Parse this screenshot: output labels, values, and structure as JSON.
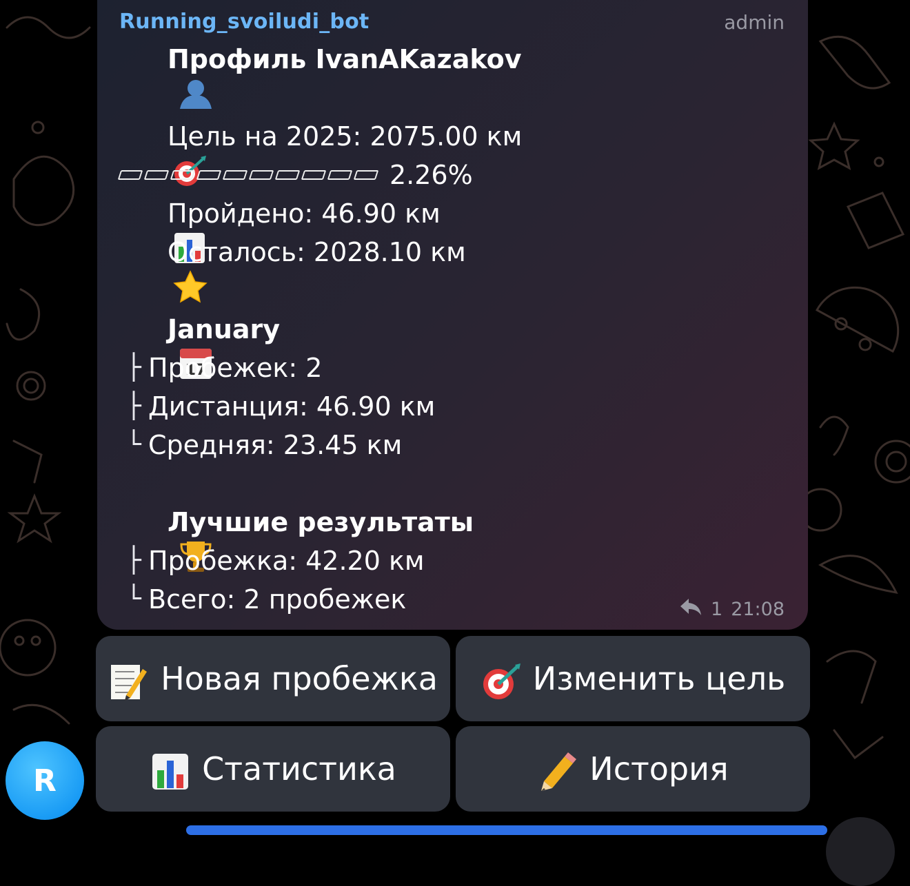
{
  "message": {
    "sender": "Running_svoiludi_bot",
    "role": "admin",
    "header": "Профиль IvanAKazakov",
    "goal": "Цель на 2025: 2075.00 км",
    "progress_percent": "2.26%",
    "progress_value": 0.0226,
    "done": "Пройдено: 46.90 км",
    "left": "Осталось: 2028.10 км",
    "month_title": "January",
    "month_stats": [
      {
        "prefix": "├",
        "text": "Пробежек: 2"
      },
      {
        "prefix": "├",
        "text": "Дистанция: 46.90 км"
      },
      {
        "prefix": "└",
        "text": "Средняя: 23.45 км"
      }
    ],
    "best_title": "Лучшие результаты",
    "best_stats": [
      {
        "prefix": "├",
        "text": "Пробежка: 42.20 км"
      },
      {
        "prefix": "└",
        "text": "Всего: 2 пробежек"
      }
    ],
    "reply_count": "1",
    "time": "21:08"
  },
  "keyboard": {
    "new_run": "Новая пробежка",
    "change_goal": "Изменить цель",
    "statistics": "Статистика",
    "history": "История"
  },
  "avatar": {
    "letter": "R",
    "color": "#1a9cf5"
  },
  "icons": {
    "profile": "user-silhouette-icon",
    "goal": "target-icon",
    "done": "bar-chart-icon",
    "left": "star-icon",
    "month": "calendar-icon",
    "best": "trophy-icon",
    "new_run": "memo-icon",
    "history": "pencil-icon"
  },
  "colors": {
    "accent": "#6cb6f6",
    "avatar": "#1a9cf5"
  }
}
